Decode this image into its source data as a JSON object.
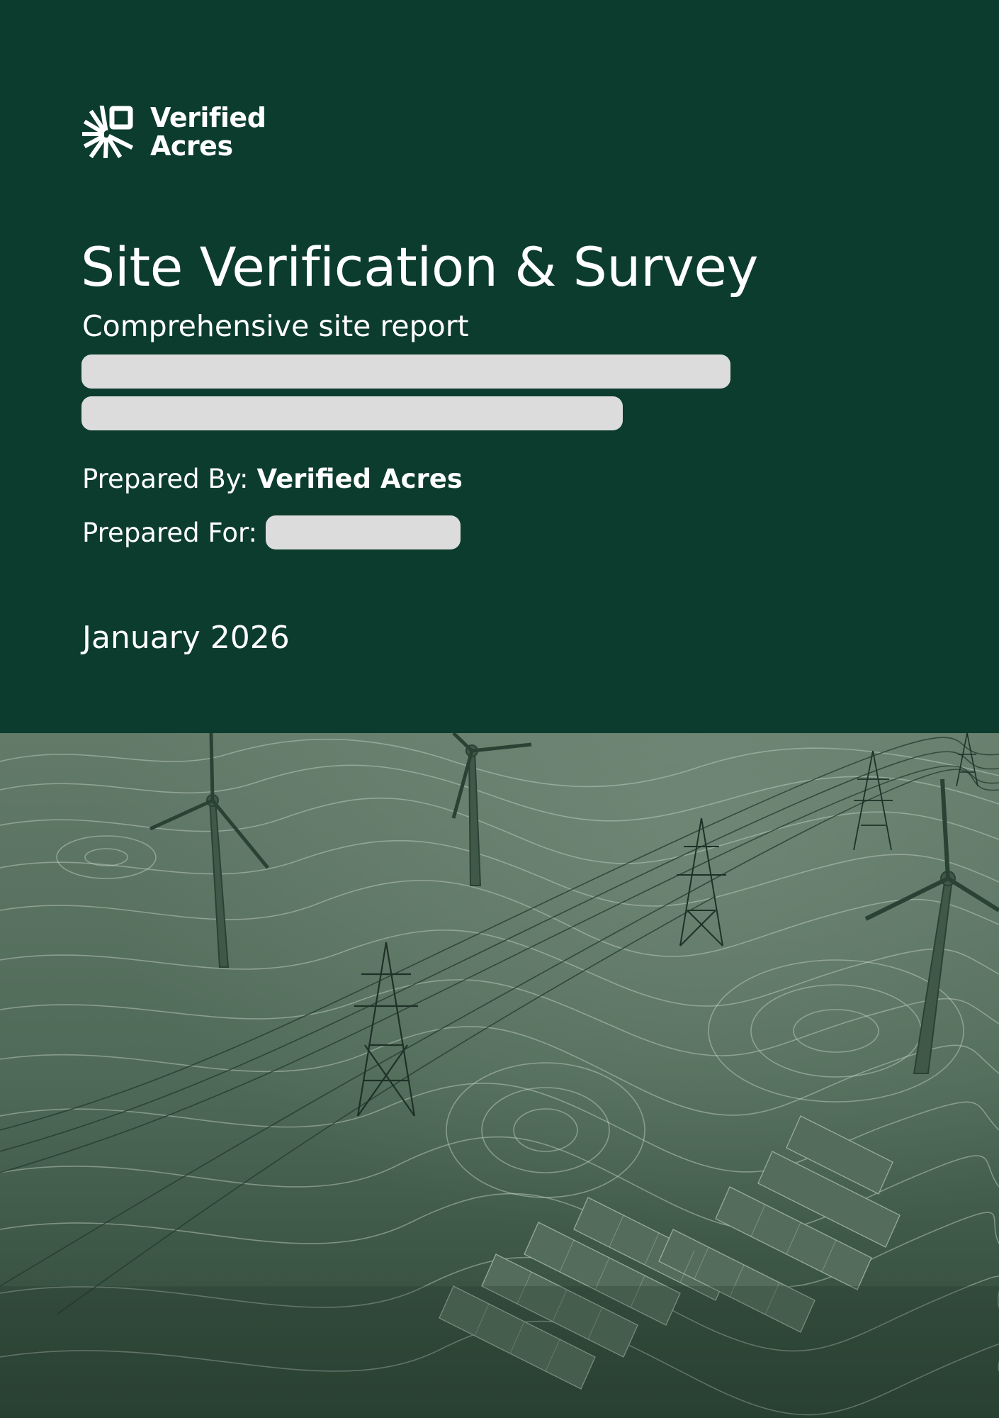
{
  "brand": {
    "name_line1": "Verified",
    "name_line2": "Acres",
    "logo_icon": "verified-acres-logo-icon"
  },
  "cover": {
    "title": "Site Verification & Survey",
    "subtitle": "Comprehensive site report",
    "prepared_by_label": "Prepared By:",
    "prepared_by_value": "Verified Acres",
    "prepared_for_label": "Prepared For:",
    "date": "January 2026"
  },
  "colors": {
    "header_background": "#0c3c2e",
    "illustration_background": "#566f5e",
    "text": "#ffffff",
    "redaction": "#dcdcdc"
  }
}
